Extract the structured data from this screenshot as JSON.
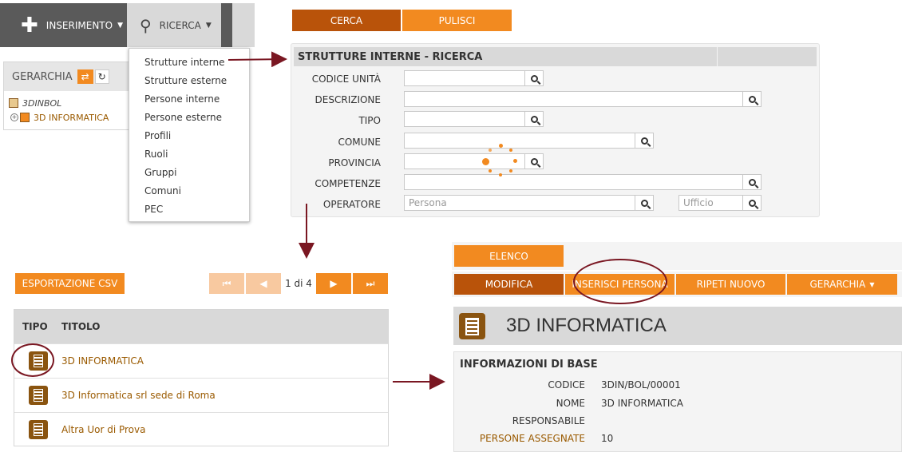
{
  "toolbar": {
    "insert_label": "INSERIMENTO",
    "search_label": "RICERCA"
  },
  "hierarchy": {
    "title": "GERARCHIA",
    "items": [
      {
        "label": "3DINBOL"
      },
      {
        "label": "3D INFORMATICA"
      }
    ]
  },
  "search_menu": {
    "items": [
      "Strutture interne",
      "Strutture esterne",
      "Persone interne",
      "Persone esterne",
      "Profili",
      "Ruoli",
      "Gruppi",
      "Comuni",
      "PEC"
    ]
  },
  "search_form": {
    "cerca_label": "CERCA",
    "pulisci_label": "PULISCI",
    "title": "STRUTTURE INTERNE - RICERCA",
    "fields": {
      "codice_unita": "CODICE UNITÀ",
      "descrizione": "DESCRIZIONE",
      "tipo": "TIPO",
      "comune": "COMUNE",
      "provincia": "PROVINCIA",
      "competenze": "COMPETENZE",
      "operatore": "OPERATORE"
    },
    "operatore_placeholder": "Persona",
    "ufficio_placeholder": "Ufficio"
  },
  "results": {
    "export_label": "ESPORTAZIONE CSV",
    "page_info": "1 di 4",
    "columns": [
      "TIPO",
      "TITOLO"
    ],
    "rows": [
      {
        "title": "3D INFORMATICA"
      },
      {
        "title": "3D Informatica srl sede di Roma"
      },
      {
        "title": "Altra Uor di Prova"
      }
    ]
  },
  "detail": {
    "elenco_label": "ELENCO",
    "actions": [
      "MODIFICA",
      "INSERISCI PERSONA",
      "RIPETI NUOVO",
      "GERARCHIA"
    ],
    "title": "3D INFORMATICA",
    "section_title": "INFORMAZIONI DI BASE",
    "labels": {
      "codice": "CODICE",
      "nome": "NOME",
      "responsabile": "RESPONSABILE",
      "persone_assegnate": "PERSONE ASSEGNATE"
    },
    "values": {
      "codice": "3DIN/BOL/00001",
      "nome": "3D INFORMATICA",
      "responsabile": "",
      "persone_assegnate": "10"
    }
  },
  "colors": {
    "accent_orange": "#f28a20",
    "dark_orange": "#b9530a",
    "brown_icon": "#8a5410",
    "annotation": "#7a1722",
    "toolbar_gray": "#5a5a5a"
  }
}
